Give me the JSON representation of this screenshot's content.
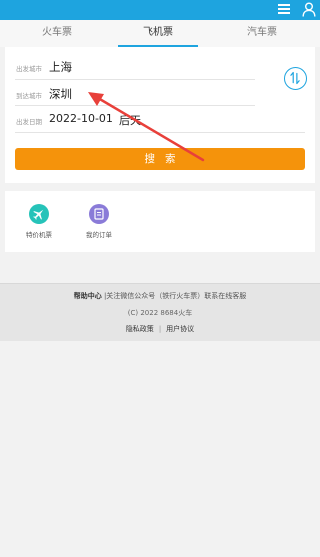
{
  "colors": {
    "accent": "#1ea4df",
    "search_button": "#f5930b",
    "arrow": "#e8403a",
    "flight_icon_bg": "#26c3b9",
    "orders_icon_bg": "#8a7bd8"
  },
  "header": {
    "menu_icon": "hamburger-icon",
    "user_icon": "user-icon"
  },
  "tabs": [
    {
      "label": "火车票",
      "active": false
    },
    {
      "label": "飞机票",
      "active": true
    },
    {
      "label": "汽车票",
      "active": false
    }
  ],
  "form": {
    "from_label": "出发城市",
    "from_value": "上海",
    "to_label": "到达城市",
    "to_value": "深圳",
    "date_label": "出发日期",
    "date_value": "2022-10-01",
    "date_weekday": "后天",
    "swap_icon": "swap-icon",
    "search_label": "搜索"
  },
  "shortcuts": [
    {
      "label": "特价机票",
      "icon": "airplane-icon"
    },
    {
      "label": "我的订单",
      "icon": "orders-icon"
    }
  ],
  "footer": {
    "help_label": "帮助中心",
    "help_text": "|关注微信公众号（铁行火车票）联系在线客服",
    "copyright": "(C) 2022 8684火车",
    "privacy_label": "隐私政策",
    "divider": "|",
    "agreement_label": "用户协议"
  }
}
